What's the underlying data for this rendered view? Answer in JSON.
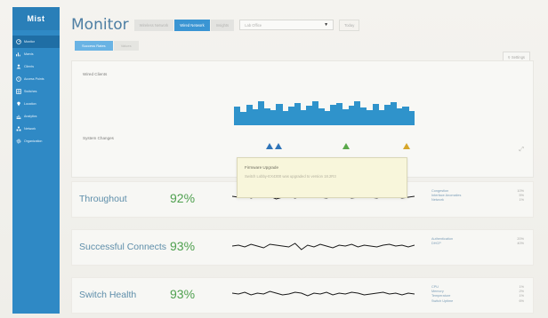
{
  "app": {
    "logo": "Mist"
  },
  "sidebar": {
    "items": [
      {
        "label": "Monitor",
        "icon": "gauge-icon"
      },
      {
        "label": "Marvis",
        "icon": "chart-icon"
      },
      {
        "label": "Clients",
        "icon": "users-icon"
      },
      {
        "label": "Access Points",
        "icon": "clock-icon"
      },
      {
        "label": "Switches",
        "icon": "grid-icon"
      },
      {
        "label": "Location",
        "icon": "pin-icon"
      },
      {
        "label": "Analytics",
        "icon": "bar-chart-icon"
      },
      {
        "label": "Network",
        "icon": "network-icon"
      },
      {
        "label": "Organization",
        "icon": "gear-icon"
      }
    ]
  },
  "header": {
    "title": "Monitor",
    "tabs": [
      {
        "label": "Wireless Network"
      },
      {
        "label": "Wired Network"
      },
      {
        "label": "Insights"
      }
    ],
    "site_select": "Lab Office",
    "date_button": "Today",
    "settings_label": "Settings"
  },
  "subtabs": [
    {
      "label": "Success Rates"
    },
    {
      "label": "Values"
    }
  ],
  "timeline": {
    "label_clients": "Wired Clients",
    "label_changes": "System Changes",
    "bars": [
      0.55,
      0.4,
      0.6,
      0.48,
      0.7,
      0.5,
      0.45,
      0.62,
      0.42,
      0.55,
      0.65,
      0.45,
      0.58,
      0.7,
      0.5,
      0.42,
      0.6,
      0.66,
      0.48,
      0.58,
      0.72,
      0.52,
      0.46,
      0.62,
      0.44,
      0.6,
      0.68,
      0.5,
      0.56,
      0.42
    ],
    "marker_colors": [
      "#2f74b8",
      "#2f74b8",
      "#5aa84a",
      "#d6a62a"
    ],
    "popover": {
      "title": "Firmware Upgrade",
      "description": "Switch Lobby-EX4300 was upgraded to version 18.2R3"
    }
  },
  "metrics": [
    {
      "name": "Throughout",
      "value": "92%",
      "series": [
        18,
        17,
        19,
        16,
        18,
        17,
        18,
        15,
        17,
        18,
        16,
        18,
        17,
        19,
        17,
        16,
        18,
        17,
        18,
        16,
        17,
        18,
        17,
        16,
        18,
        17,
        18,
        16,
        17,
        18
      ],
      "classifiers": [
        {
          "label": "Congestion",
          "value": "10%"
        },
        {
          "label": "Interface Anomalies",
          "value": "5%"
        },
        {
          "label": "Network",
          "value": "1%"
        }
      ]
    },
    {
      "name": "Successful Connects",
      "value": "93%",
      "series": [
        16,
        17,
        15,
        18,
        16,
        14,
        18,
        17,
        16,
        15,
        19,
        12,
        17,
        15,
        18,
        16,
        14,
        17,
        16,
        18,
        15,
        17,
        16,
        15,
        17,
        18,
        16,
        17,
        15,
        17
      ],
      "classifiers": [
        {
          "label": "Authentication",
          "value": "20%"
        },
        {
          "label": "DHCP",
          "value": "40%"
        }
      ]
    },
    {
      "name": "Switch Health",
      "value": "93%",
      "series": [
        17,
        16,
        18,
        15,
        17,
        16,
        19,
        17,
        15,
        16,
        18,
        17,
        14,
        17,
        16,
        18,
        15,
        17,
        16,
        18,
        17,
        15,
        16,
        17,
        18,
        16,
        17,
        15,
        17,
        16
      ],
      "classifiers": [
        {
          "label": "CPU",
          "value": "1%"
        },
        {
          "label": "Memory",
          "value": "2%"
        },
        {
          "label": "Temperature",
          "value": "1%"
        },
        {
          "label": "Switch Uptime",
          "value": "6%"
        }
      ]
    }
  ],
  "colors": {
    "accent": "#2f89c5",
    "good": "#4fa04f",
    "bars": "#2f93cb"
  }
}
